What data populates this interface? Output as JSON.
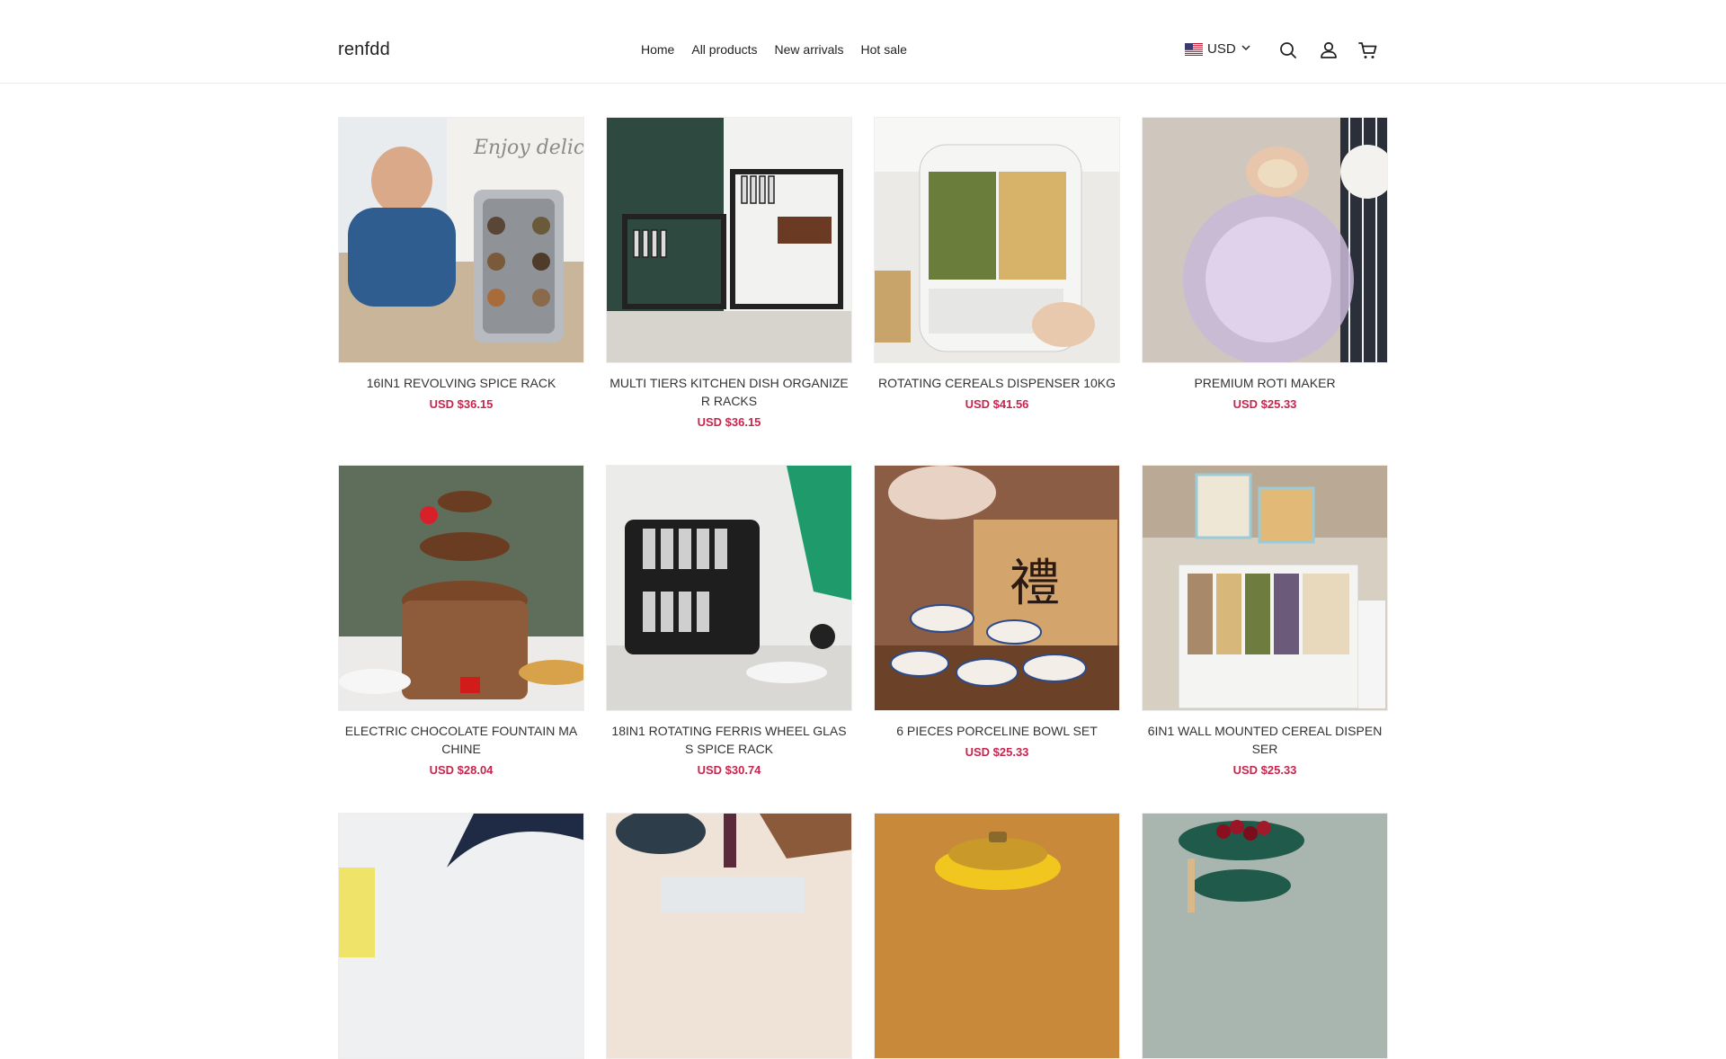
{
  "store": {
    "name": "renfdd"
  },
  "nav": {
    "items": [
      {
        "label": "Home"
      },
      {
        "label": "All products"
      },
      {
        "label": "New arrivals"
      },
      {
        "label": "Hot sale"
      }
    ]
  },
  "header": {
    "currency": "USD",
    "icons": [
      "us-flag-icon",
      "chevron-down-icon",
      "search-icon",
      "account-icon",
      "cart-icon"
    ]
  },
  "products": [
    {
      "title": "16IN1 REVOLVING SPICE RACK",
      "price": "USD $36.15",
      "image_text": "Enjoy delicious life"
    },
    {
      "title": "MULTI TIERS KITCHEN DISH ORGANIZER RACKS",
      "price": "USD $36.15"
    },
    {
      "title": "ROTATING CEREALS DISPENSER 10KG",
      "price": "USD $41.56"
    },
    {
      "title": "PREMIUM ROTI MAKER",
      "price": "USD $25.33"
    },
    {
      "title": "ELECTRIC CHOCOLATE FOUNTAIN MACHINE",
      "price": "USD $28.04"
    },
    {
      "title": "18IN1 ROTATING FERRIS WHEEL GLASS SPICE RACK",
      "price": "USD $30.74"
    },
    {
      "title": "6 PIECES PORCELINE BOWL SET",
      "price": "USD $25.33"
    },
    {
      "title": "6IN1 WALL MOUNTED CEREAL DISPENSER",
      "price": "USD $25.33"
    },
    {
      "title": "",
      "price": ""
    },
    {
      "title": "",
      "price": ""
    },
    {
      "title": "",
      "price": ""
    },
    {
      "title": "",
      "price": ""
    }
  ],
  "colors": {
    "price": "#c7254e",
    "text": "#222222",
    "border": "#ececec"
  }
}
